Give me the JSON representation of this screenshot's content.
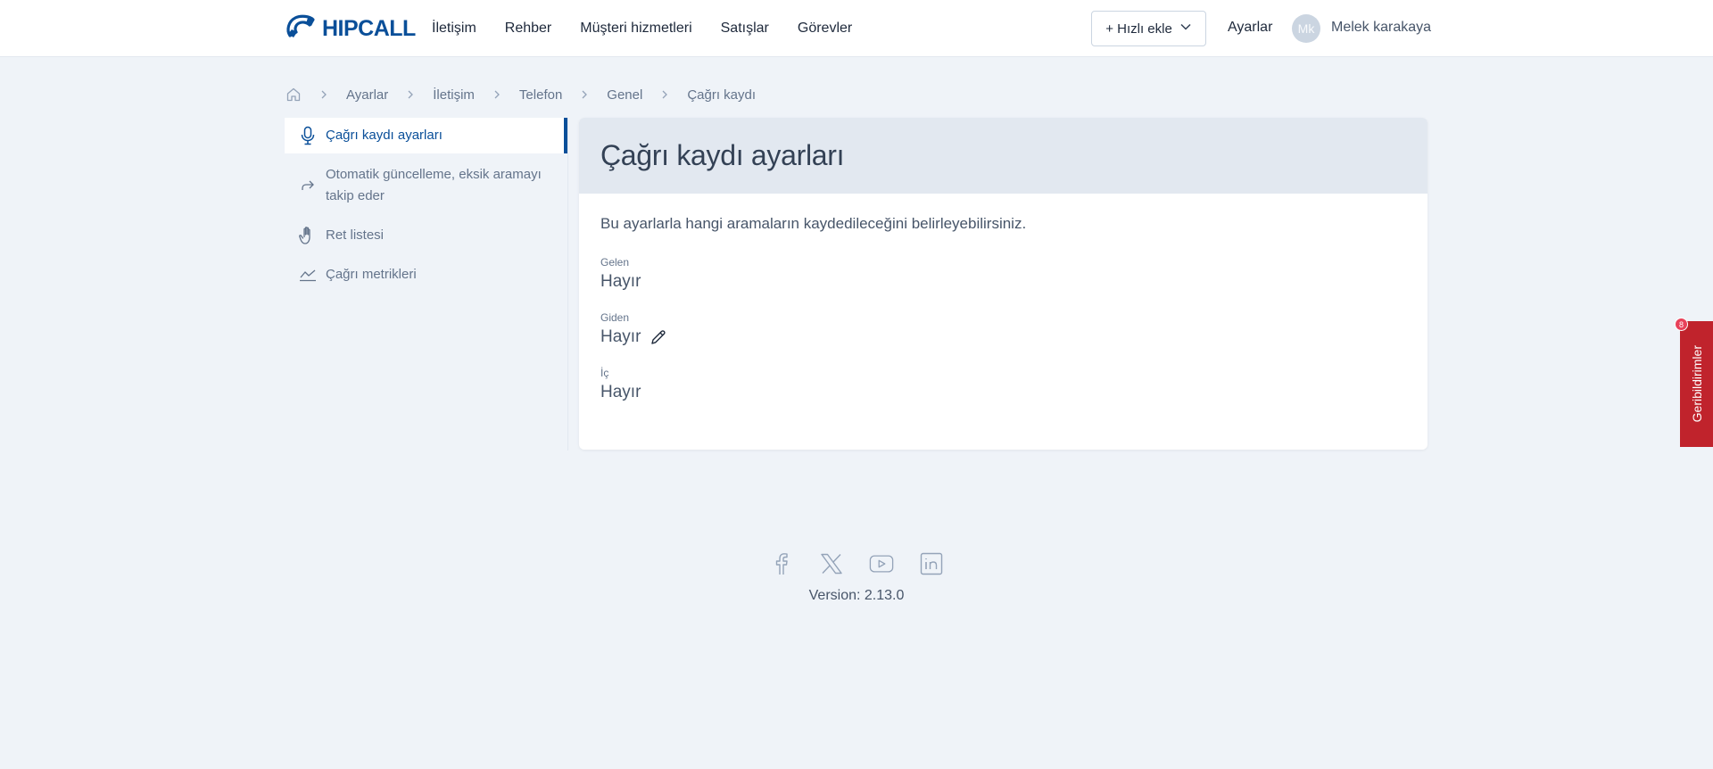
{
  "header": {
    "logo_text": "HIPCALL",
    "nav": [
      "İletişim",
      "Rehber",
      "Müşteri hizmetleri",
      "Satışlar",
      "Görevler"
    ],
    "quick_add": "+ Hızlı ekle",
    "settings": "Ayarlar",
    "avatar_initials": "Mk",
    "username": "Melek karakaya"
  },
  "breadcrumb": [
    "Ayarlar",
    "İletişim",
    "Telefon",
    "Genel",
    "Çağrı kaydı"
  ],
  "sidebar": {
    "items": [
      {
        "label": "Çağrı kaydı ayarları",
        "icon": "microphone-icon",
        "active": true
      },
      {
        "label": "Otomatik güncelleme, eksik aramayı takip eder",
        "icon": "share-arrow-icon"
      },
      {
        "label": "Ret listesi",
        "icon": "hand-icon"
      },
      {
        "label": "Çağrı metrikleri",
        "icon": "chart-line-icon"
      }
    ]
  },
  "main": {
    "title": "Çağrı kaydı ayarları",
    "description": "Bu ayarlarla hangi aramaların kaydedileceğini belirleyebilirsiniz.",
    "fields": [
      {
        "label": "Gelen",
        "value": "Hayır"
      },
      {
        "label": "Giden",
        "value": "Hayır"
      },
      {
        "label": "İç",
        "value": "Hayır"
      }
    ]
  },
  "footer": {
    "socials": [
      "facebook-icon",
      "x-icon",
      "youtube-icon",
      "linkedin-icon"
    ],
    "version": "Version: 2.13.0"
  },
  "feedback": {
    "label": "Geribildirimler",
    "badge": "8"
  },
  "colors": {
    "brand": "#0a4f99",
    "background": "#eff3f8",
    "feedback": "#c0232c"
  }
}
